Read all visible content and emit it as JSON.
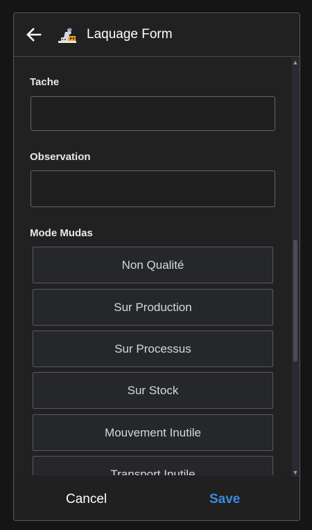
{
  "header": {
    "title": "Laquage Form",
    "back_icon": "arrow-left-icon",
    "app_icon": "factory-icon"
  },
  "form": {
    "tache": {
      "label": "Tache",
      "value": ""
    },
    "observation": {
      "label": "Observation",
      "value": ""
    },
    "mode_mudas": {
      "label": "Mode Mudas",
      "options": [
        "Non Qualité",
        "Sur Production",
        "Sur Processus",
        "Sur Stock",
        "Mouvement Inutile",
        "Transport Inutile"
      ]
    }
  },
  "footer": {
    "cancel_label": "Cancel",
    "save_label": "Save"
  },
  "colors": {
    "accent": "#3c8ae0",
    "background": "#212121"
  }
}
